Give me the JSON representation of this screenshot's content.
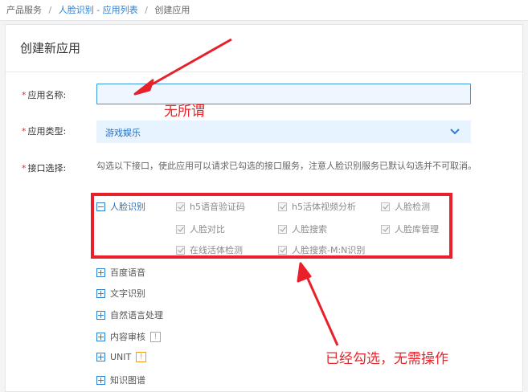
{
  "breadcrumb": {
    "product_services": "产品服务",
    "separator": "/",
    "face_app_list": "人脸识别 - 应用列表",
    "create_app": "创建应用"
  },
  "panel": {
    "title": "创建新应用"
  },
  "form": {
    "app_name_label": "应用名称:",
    "app_name_value": "",
    "app_type_label": "应用类型:",
    "app_type_value": "游戏娱乐",
    "api_select_label": "接口选择:",
    "api_hint": "勾选以下接口，使此应用可以请求已勾选的接口服务，注意人脸识别服务已默认勾选并不可取消。"
  },
  "groups": {
    "face": {
      "label": "人脸识别",
      "apis": [
        "h5语音验证码",
        "h5活体视频分析",
        "人脸检测",
        "人脸对比",
        "人脸搜索",
        "人脸库管理",
        "在线活体检测",
        "人脸搜索-M:N识别"
      ]
    },
    "others": [
      {
        "label": "百度语音",
        "badge": ""
      },
      {
        "label": "文字识别",
        "badge": ""
      },
      {
        "label": "自然语言处理",
        "badge": ""
      },
      {
        "label": "内容审核",
        "badge": "!"
      },
      {
        "label": "UNIT",
        "badge": "!"
      },
      {
        "label": "知识图谱",
        "badge": ""
      }
    ]
  },
  "annotations": {
    "type_note": "无所谓",
    "checked_note": "已经勾选，无需操作"
  },
  "colors": {
    "accent": "#2a7fd6",
    "annotation_red": "#e8202a",
    "warning_badge": "#f59b22"
  }
}
